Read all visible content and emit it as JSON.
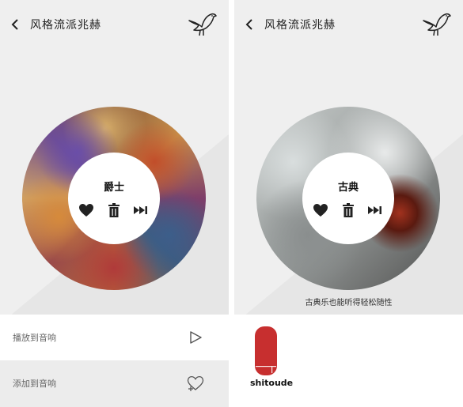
{
  "left": {
    "header": {
      "title": "风格流派兆赫",
      "back_icon": "chevron-left-icon",
      "bird_icon": "bird-icon"
    },
    "disc": {
      "genre": "爵士"
    },
    "actions": {
      "play_label": "播放到音响",
      "play_icon": "play-outline-icon",
      "add_label": "添加到音响",
      "add_icon": "heart-plus-icon"
    }
  },
  "right": {
    "header": {
      "title": "风格流派兆赫",
      "back_icon": "chevron-left-icon",
      "bird_icon": "bird-icon"
    },
    "disc": {
      "genre": "古典"
    },
    "caption": "古典乐也能听得轻松随性",
    "device": {
      "name": "shitoude",
      "color": "#c72f2f"
    }
  },
  "colors": {
    "background": "#efefef",
    "panel": "#ffffff",
    "accent_red": "#c72f2f"
  }
}
